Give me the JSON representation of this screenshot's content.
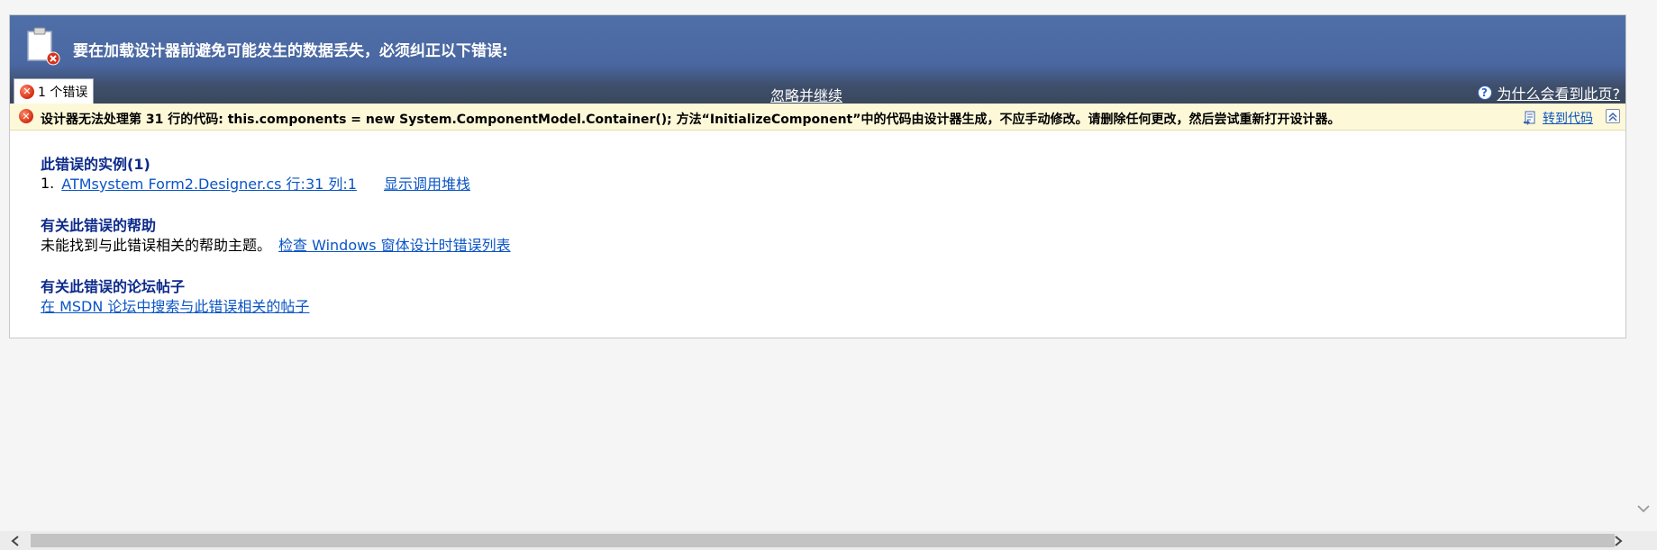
{
  "banner": {
    "title": "要在加载设计器前避免可能发生的数据丢失，必须纠正以下错误:",
    "error_count_label": "1 个错误",
    "ignore_label": "忽略并继续",
    "why_label": "为什么会看到此页?"
  },
  "error_bar": {
    "message": "设计器无法处理第 31 行的代码: this.components = new System.ComponentModel.Container(); 方法“InitializeComponent”中的代码由设计器生成，不应手动修改。请删除任何更改，然后尝试重新打开设计器。",
    "goto_code_label": "转到代码"
  },
  "details": {
    "instances_title": "此错误的实例(1)",
    "instance_index": "1.",
    "instance_link": "ATMsystem Form2.Designer.cs 行:31 列:1",
    "show_stack_label": "显示调用堆栈",
    "help_title": "有关此错误的帮助",
    "help_text": "未能找到与此错误相关的帮助主题。",
    "help_link": "检查 Windows 窗体设计时错误列表",
    "forum_title": "有关此错误的论坛帖子",
    "forum_link": "在 MSDN 论坛中搜索与此错误相关的帖子"
  },
  "icons": {
    "banner": "document-error-icon",
    "error": "error-circle-icon",
    "help": "help-icon",
    "goto": "goto-code-icon",
    "collapse": "collapse-icon"
  },
  "colors": {
    "banner_top": "#4f6fa8",
    "banner_bottom": "#3a475c",
    "error_bar": "#fdf8d8",
    "link": "#0b55c6",
    "section_title": "#0c2a8a"
  }
}
